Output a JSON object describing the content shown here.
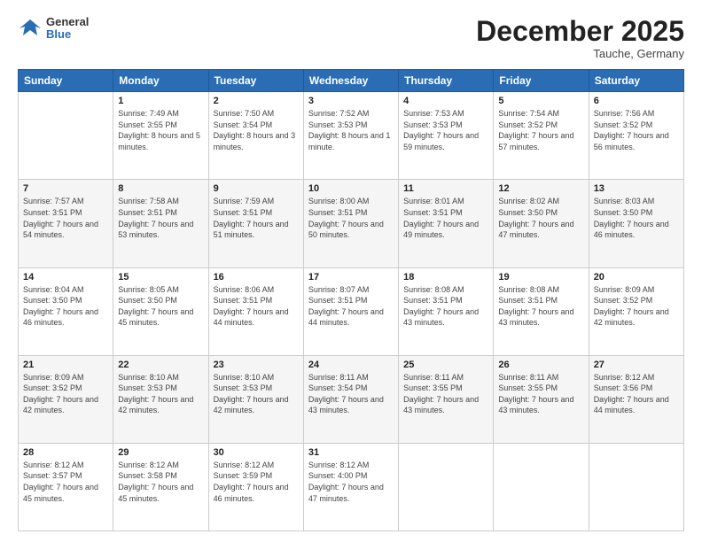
{
  "header": {
    "logo": {
      "general": "General",
      "blue": "Blue"
    },
    "month": "December 2025",
    "location": "Tauche, Germany"
  },
  "days_of_week": [
    "Sunday",
    "Monday",
    "Tuesday",
    "Wednesday",
    "Thursday",
    "Friday",
    "Saturday"
  ],
  "weeks": [
    [
      {
        "day": "",
        "info": ""
      },
      {
        "day": "1",
        "info": "Sunrise: 7:49 AM\nSunset: 3:55 PM\nDaylight: 8 hours\nand 5 minutes."
      },
      {
        "day": "2",
        "info": "Sunrise: 7:50 AM\nSunset: 3:54 PM\nDaylight: 8 hours\nand 3 minutes."
      },
      {
        "day": "3",
        "info": "Sunrise: 7:52 AM\nSunset: 3:53 PM\nDaylight: 8 hours\nand 1 minute."
      },
      {
        "day": "4",
        "info": "Sunrise: 7:53 AM\nSunset: 3:53 PM\nDaylight: 7 hours\nand 59 minutes."
      },
      {
        "day": "5",
        "info": "Sunrise: 7:54 AM\nSunset: 3:52 PM\nDaylight: 7 hours\nand 57 minutes."
      },
      {
        "day": "6",
        "info": "Sunrise: 7:56 AM\nSunset: 3:52 PM\nDaylight: 7 hours\nand 56 minutes."
      }
    ],
    [
      {
        "day": "7",
        "info": "Sunrise: 7:57 AM\nSunset: 3:51 PM\nDaylight: 7 hours\nand 54 minutes."
      },
      {
        "day": "8",
        "info": "Sunrise: 7:58 AM\nSunset: 3:51 PM\nDaylight: 7 hours\nand 53 minutes."
      },
      {
        "day": "9",
        "info": "Sunrise: 7:59 AM\nSunset: 3:51 PM\nDaylight: 7 hours\nand 51 minutes."
      },
      {
        "day": "10",
        "info": "Sunrise: 8:00 AM\nSunset: 3:51 PM\nDaylight: 7 hours\nand 50 minutes."
      },
      {
        "day": "11",
        "info": "Sunrise: 8:01 AM\nSunset: 3:51 PM\nDaylight: 7 hours\nand 49 minutes."
      },
      {
        "day": "12",
        "info": "Sunrise: 8:02 AM\nSunset: 3:50 PM\nDaylight: 7 hours\nand 47 minutes."
      },
      {
        "day": "13",
        "info": "Sunrise: 8:03 AM\nSunset: 3:50 PM\nDaylight: 7 hours\nand 46 minutes."
      }
    ],
    [
      {
        "day": "14",
        "info": "Sunrise: 8:04 AM\nSunset: 3:50 PM\nDaylight: 7 hours\nand 46 minutes."
      },
      {
        "day": "15",
        "info": "Sunrise: 8:05 AM\nSunset: 3:50 PM\nDaylight: 7 hours\nand 45 minutes."
      },
      {
        "day": "16",
        "info": "Sunrise: 8:06 AM\nSunset: 3:51 PM\nDaylight: 7 hours\nand 44 minutes."
      },
      {
        "day": "17",
        "info": "Sunrise: 8:07 AM\nSunset: 3:51 PM\nDaylight: 7 hours\nand 44 minutes."
      },
      {
        "day": "18",
        "info": "Sunrise: 8:08 AM\nSunset: 3:51 PM\nDaylight: 7 hours\nand 43 minutes."
      },
      {
        "day": "19",
        "info": "Sunrise: 8:08 AM\nSunset: 3:51 PM\nDaylight: 7 hours\nand 43 minutes."
      },
      {
        "day": "20",
        "info": "Sunrise: 8:09 AM\nSunset: 3:52 PM\nDaylight: 7 hours\nand 42 minutes."
      }
    ],
    [
      {
        "day": "21",
        "info": "Sunrise: 8:09 AM\nSunset: 3:52 PM\nDaylight: 7 hours\nand 42 minutes."
      },
      {
        "day": "22",
        "info": "Sunrise: 8:10 AM\nSunset: 3:53 PM\nDaylight: 7 hours\nand 42 minutes."
      },
      {
        "day": "23",
        "info": "Sunrise: 8:10 AM\nSunset: 3:53 PM\nDaylight: 7 hours\nand 42 minutes."
      },
      {
        "day": "24",
        "info": "Sunrise: 8:11 AM\nSunset: 3:54 PM\nDaylight: 7 hours\nand 43 minutes."
      },
      {
        "day": "25",
        "info": "Sunrise: 8:11 AM\nSunset: 3:55 PM\nDaylight: 7 hours\nand 43 minutes."
      },
      {
        "day": "26",
        "info": "Sunrise: 8:11 AM\nSunset: 3:55 PM\nDaylight: 7 hours\nand 43 minutes."
      },
      {
        "day": "27",
        "info": "Sunrise: 8:12 AM\nSunset: 3:56 PM\nDaylight: 7 hours\nand 44 minutes."
      }
    ],
    [
      {
        "day": "28",
        "info": "Sunrise: 8:12 AM\nSunset: 3:57 PM\nDaylight: 7 hours\nand 45 minutes."
      },
      {
        "day": "29",
        "info": "Sunrise: 8:12 AM\nSunset: 3:58 PM\nDaylight: 7 hours\nand 45 minutes."
      },
      {
        "day": "30",
        "info": "Sunrise: 8:12 AM\nSunset: 3:59 PM\nDaylight: 7 hours\nand 46 minutes."
      },
      {
        "day": "31",
        "info": "Sunrise: 8:12 AM\nSunset: 4:00 PM\nDaylight: 7 hours\nand 47 minutes."
      },
      {
        "day": "",
        "info": ""
      },
      {
        "day": "",
        "info": ""
      },
      {
        "day": "",
        "info": ""
      }
    ]
  ]
}
